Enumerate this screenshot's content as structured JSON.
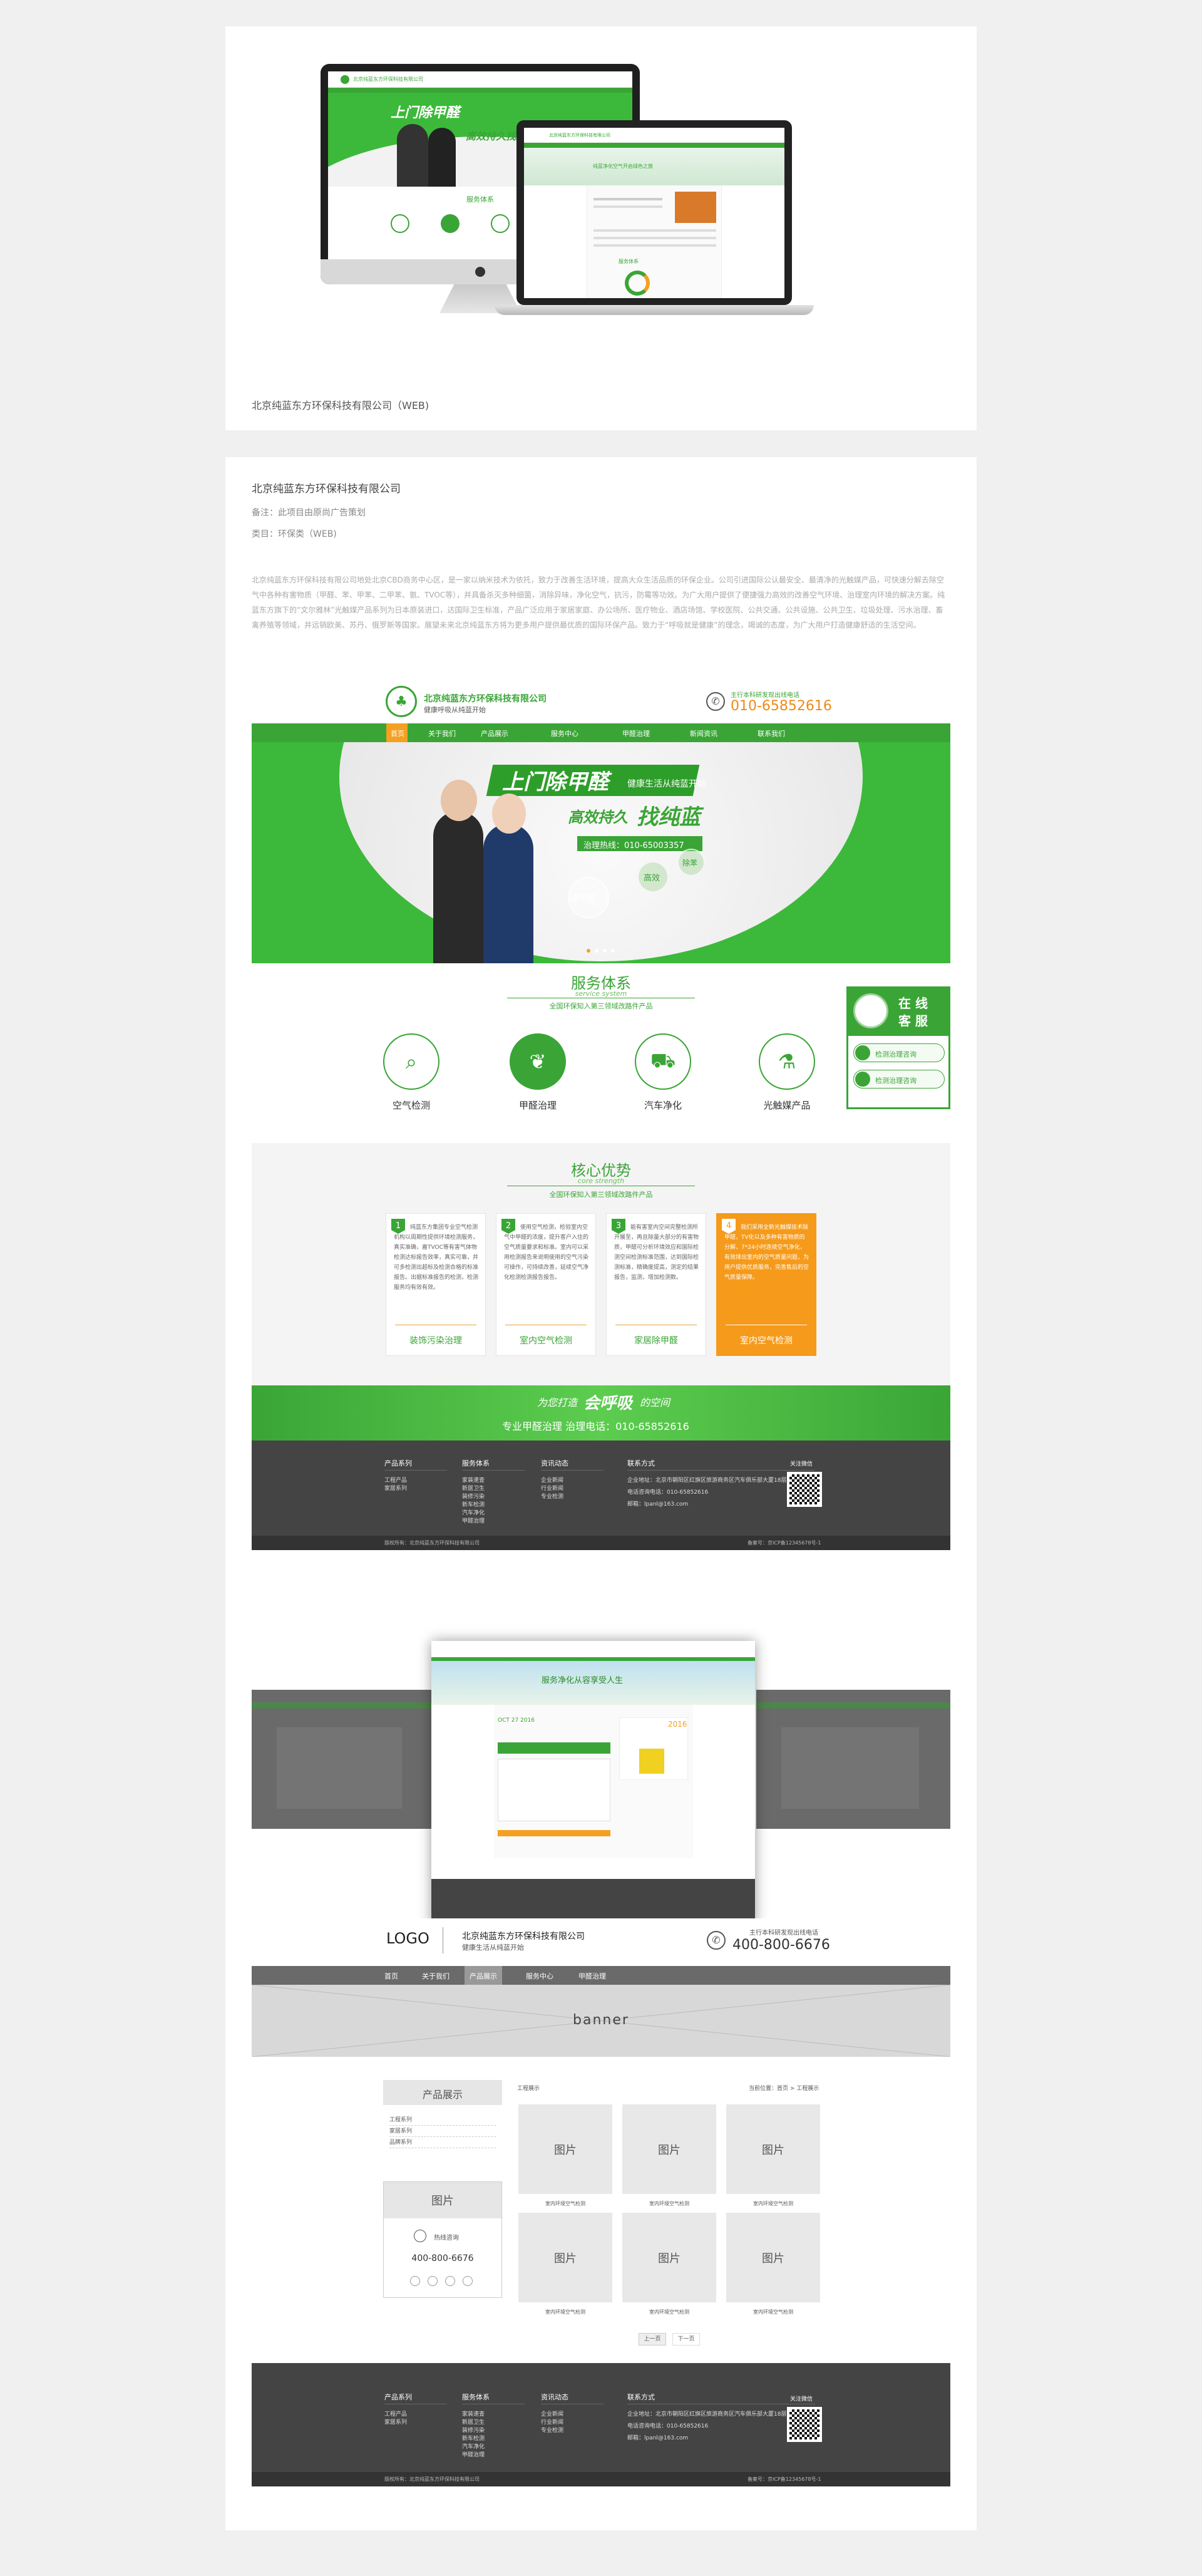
{
  "card1": {
    "caption": "北京纯蓝东方环保科技有限公司（WEB)",
    "monitor": {
      "company": "北京纯蓝东方环保科技有限公司",
      "slogan1": "上门除甲醛",
      "slogan2": "高效持久找纯蓝",
      "service": "服务体系"
    },
    "laptop": {
      "company": "北京纯蓝东方环保科技有限公司",
      "banner": "纯蓝净化空气开启绿色之旅",
      "service": "服务体系"
    }
  },
  "project": {
    "title": "北京纯蓝东方环保科技有限公司",
    "note": "备注：此项目由原尚广告策划",
    "category": "类目：环保类（WEB)",
    "description": "北京纯蓝东方环保科技有限公司地处北京CBD商务中心区，是一家以纳米技术为依托，致力于改善生活环境，提高大众生活品质的环保企业。公司引进国际公认最安全、最清净的光触媒产品，可快速分解去除空气中各种有害物质（甲醛、苯、甲苯、二甲苯、氨、TVOC等），并具备杀灭多种细菌，消除异味，净化空气，抗污，防霉等功效。为广大用户提供了便捷强力高效的改善空气环境、治理室内环境的解决方案。纯蓝东方旗下的“文尔雅林”光触媒产品系列为日本原装进口，达国际卫生标准，产品广泛应用于家居家庭、办公场所、医疗物业、酒店场馆、学校医院、公共交通、公共设施、公共卫生、垃圾处理、污水治理、畜禽养殖等领域，并远销欧美、苏丹、俄罗斯等国家。展望未来北京纯蓝东方将为更多用户提供最优质的国际环保产品。致力于“呼吸就是健康”的理念，竭诚的态度，为广大用户打造健康舒适的生活空间。"
  },
  "site": {
    "company": "北京纯蓝东方环保科技有限公司",
    "slogan": "健康呼吸从纯蓝开始",
    "hotline_label": "主行本科研发现出线电话",
    "hotline": "010-65852616",
    "nav": [
      "首页",
      "关于我们",
      "产品展示",
      "服务中心",
      "甲醛治理",
      "新闻资讯",
      "联系我们"
    ],
    "hero": {
      "headline": "上门除甲醛",
      "tag": "健康生活从纯蓝开始",
      "headline2a": "高效持久",
      "headline2b": "找纯蓝",
      "phone": "治理热线：010-65003357",
      "b1": "除甲醛",
      "b2": "高效",
      "b3": "除苯"
    },
    "service": {
      "title": "服务体系",
      "sub": "service system",
      "desc": "全国环保知入第三领域改路件产品",
      "items": [
        {
          "label": "空气检测",
          "icon": "magnifier-icon"
        },
        {
          "label": "甲醛治理",
          "icon": "leaf-icon"
        },
        {
          "label": "汽车净化",
          "icon": "car-icon"
        },
        {
          "label": "光触媒产品",
          "icon": "spray-icon"
        }
      ]
    },
    "online": {
      "title1": "在 线",
      "title2": "客 服",
      "btn1": "检测治理咨询",
      "btn2": "检测治理咨询"
    },
    "core": {
      "title": "核心优势",
      "sub": "core strength",
      "desc": "全国环保知入第三领域改路件产品",
      "items": [
        {
          "n": "1",
          "text": "纯蓝东方集团专业空气检测机构以周期性提供环境检测服务，真实准确，嘉TVOC等有害气体物检测达标报告效率，真实可靠，并可多检测出超标及检测合格的标准报告。出据标准报告的检测，检测服务均有效有效。",
          "label": "装饰污染治理"
        },
        {
          "n": "2",
          "text": "使用空气检测，检验室内空气中甲醛的浓度，提升客户入住的空气质量要求和标准。室内可以采用检测报告来说明使用的空气污染可操作，可持续改善，延续空气净化检测检测报告报告。",
          "label": "室内空气检测"
        },
        {
          "n": "3",
          "text": "能有害室内空间完整检测所开展至，再且除量大部分的有害物质，甲醛可分析环境效应和国际检测空间检测标准范围，达到国际检测标准，精确度提高，测定的结果报告，监测，增加检测数。",
          "label": "家居除甲醛"
        },
        {
          "n": "4",
          "text": "我们采用全新光触媒技术除甲醛，TV化以及多种有害物质的分解，7*24小时连续空气净化，有效排出室内的空气质量问题，为用户提供优质服务，完善售后的空气质量保障。",
          "label": "室内空气检测"
        }
      ]
    },
    "cta": {
      "line1a": "为您打造",
      "line1b": "会呼吸",
      "line1c": "的空间",
      "line2": "专业甲醛治理    治理电话：010-65852616"
    },
    "footer": {
      "cols": [
        {
          "title": "产品系列",
          "items": [
            "工程产品",
            "家居系列"
          ]
        },
        {
          "title": "服务体系",
          "items": [
            "家装速查",
            "新居卫生",
            "装修污染",
            "新车检测",
            "汽车净化",
            "甲醛治理"
          ]
        },
        {
          "title": "资讯动态",
          "items": [
            "企业新闻",
            "行业新闻",
            "专业检测"
          ]
        }
      ],
      "contact_title": "联系方式",
      "address": "企业地址：北京市朝阳区红旗区旅游商务区汽车俱乐部大厦18层",
      "phone": "电话咨询电话：010-65852616",
      "email": "邮箱：lpanl@163.com",
      "follow": "关注微信",
      "copyright": "版权所有：北京纯蓝东方环保科技有限公司",
      "icp": "备案号：京ICP备12345678号-1"
    }
  },
  "inner": {
    "banner": "服务净化从容享受人生",
    "date": "OCT 27 2016",
    "year": "2016"
  },
  "wire": {
    "logo": "LOGO",
    "company": "北京纯蓝东方环保科技有限公司",
    "slogan": "健康生活从纯蓝开始",
    "hotline_label": "主行本科研发现出线电话",
    "hotline": "400-800-6676",
    "nav": [
      "首页",
      "关于我们",
      "产品展示",
      "服务中心",
      "甲醛治理"
    ],
    "banner": "banner",
    "side_title": "产品展示",
    "side_items": [
      "工程系列",
      "家居系列",
      "品牌系列"
    ],
    "crumb_left": "工程展示",
    "crumb_right": "当前位置：首页 > 工程展示",
    "img": "图片",
    "caption": "室内环境空气检测",
    "contact_label": "热线咨询",
    "contact_phone": "400-800-6676",
    "prev": "上一页",
    "next": "下一页"
  }
}
